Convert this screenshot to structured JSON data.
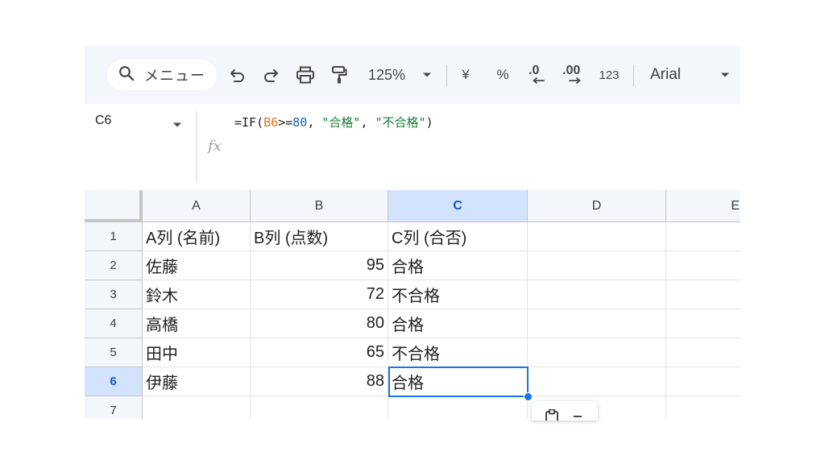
{
  "toolbar": {
    "search_label": "メニュー",
    "zoom_value": "125%",
    "currency_label": "¥",
    "percent_label": "%",
    "decrease_decimal_label": ".0",
    "increase_decimal_label": ".00",
    "number_format_label": "123",
    "font_name": "Arial"
  },
  "formula_bar": {
    "name_box": "C6",
    "fx_label": "fx",
    "formula_parts": {
      "p1": "=IF(",
      "ref": "B6",
      "p2": ">=",
      "num": "80",
      "p3": ", ",
      "s1": "\"合格\"",
      "p4": ", ",
      "s2": "\"不合格\"",
      "p5": ")"
    }
  },
  "grid": {
    "columns": [
      "A",
      "B",
      "C",
      "D",
      "E"
    ],
    "row_numbers": [
      "1",
      "2",
      "3",
      "4",
      "5",
      "6",
      "7"
    ],
    "selected_cell": "C6",
    "rows": [
      [
        "A列 (名前)",
        "B列 (点数)",
        "C列 (合否)"
      ],
      [
        "佐藤",
        "95",
        "合格"
      ],
      [
        "鈴木",
        "72",
        "不合格"
      ],
      [
        "高橋",
        "80",
        "合格"
      ],
      [
        "田中",
        "65",
        "不合格"
      ],
      [
        "伊藤",
        "88",
        "合格"
      ],
      [
        "",
        "",
        ""
      ]
    ]
  },
  "colors": {
    "accent": "#1a73e8",
    "selected_header_bg": "#d3e3fd",
    "toolbar_bg": "#f3f6fb",
    "formula_ref": "#e8711a",
    "formula_number": "#1a5fb4",
    "formula_string": "#188038"
  }
}
